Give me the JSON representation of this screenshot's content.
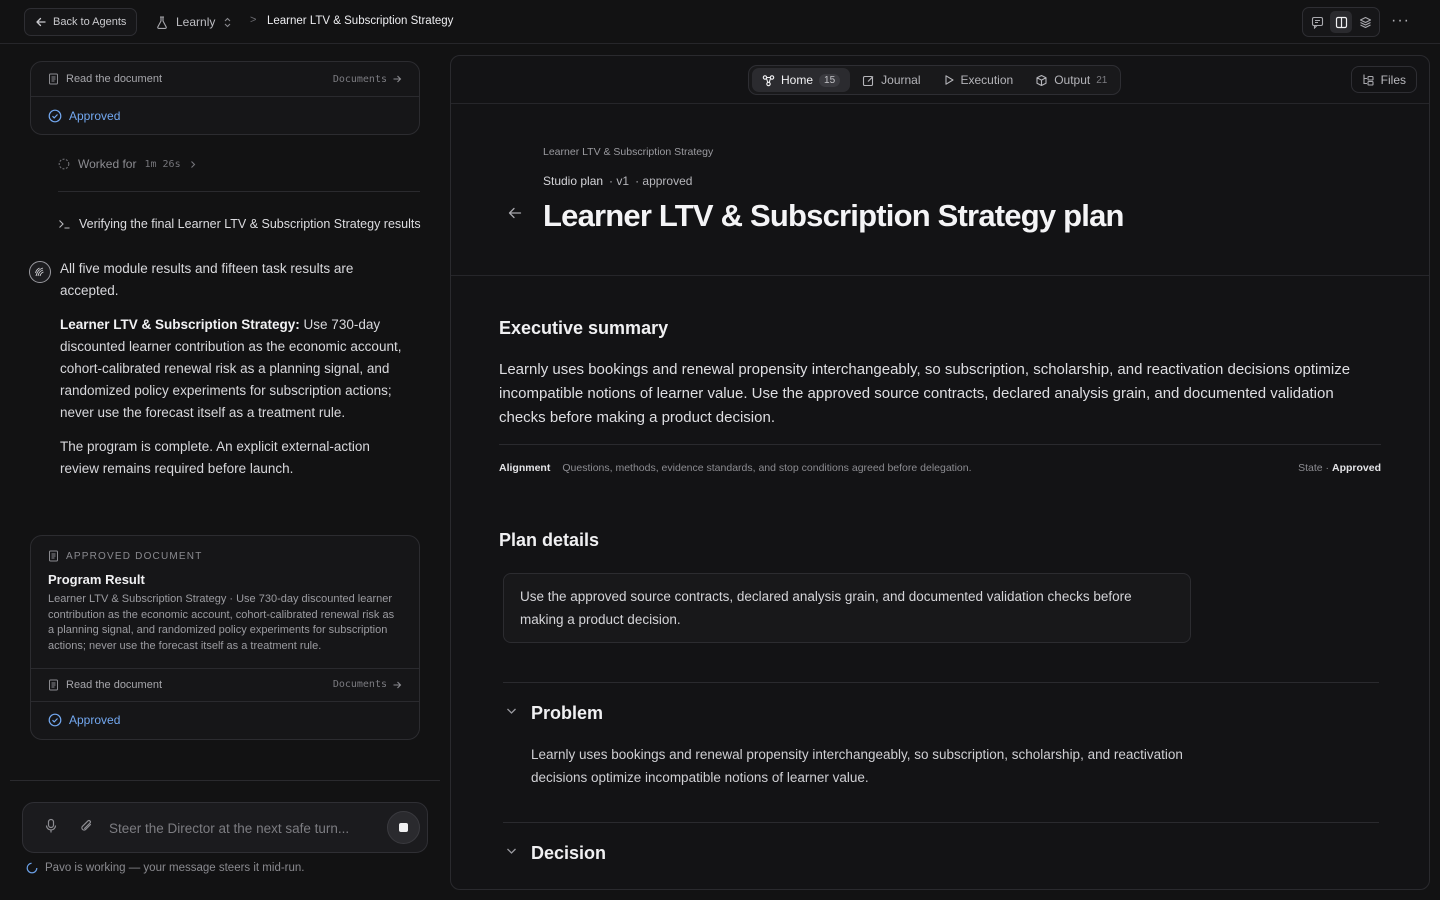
{
  "topbar": {
    "back_label": "Back to Agents",
    "project_name": "Learnly",
    "breadcrumb_sep": ">",
    "breadcrumb_title": "Learner LTV & Subscription Strategy"
  },
  "left": {
    "top_card": {
      "read_label": "Read the document",
      "docs_label": "Documents",
      "approved_label": "Approved"
    },
    "worked_label": "Worked for",
    "worked_duration": "1m 26s",
    "verify_text": "Verifying the final Learner LTV & Subscription Strategy results",
    "message": {
      "p1": "All five module results and fifteen task results are accepted.",
      "p2_bold": "Learner LTV & Subscription Strategy:",
      "p2_rest": " Use 730-day discounted learner contribution as the economic account, cohort-calibrated renewal risk as a planning signal, and randomized policy experiments for subscription actions; never use the forecast itself as a treatment rule.",
      "p3": "The program is complete. An explicit external-action review remains required before launch."
    },
    "doc_card": {
      "kicker": "APPROVED DOCUMENT",
      "title": "Program Result",
      "body": "Learner LTV & Subscription Strategy · Use 730-day discounted learner contribution as the economic account, cohort-calibrated renewal risk as a planning signal, and randomized policy experiments for subscription actions; never use the forecast itself as a treatment rule.",
      "read_label": "Read the document",
      "docs_label": "Documents",
      "approved_label": "Approved"
    },
    "composer": {
      "placeholder": "Steer the Director at the next safe turn..."
    },
    "status_text": "Pavo is working — your message steers it mid-run."
  },
  "right": {
    "tabs": [
      {
        "label": "Home",
        "count": "15"
      },
      {
        "label": "Journal",
        "count": ""
      },
      {
        "label": "Execution",
        "count": ""
      },
      {
        "label": "Output",
        "count": "21"
      }
    ],
    "files_label": "Files",
    "kicker": "Learner LTV & Subscription Strategy",
    "meta_type": "Studio plan",
    "meta_version": "· v1",
    "meta_state": "· approved",
    "title": "Learner LTV & Subscription Strategy plan",
    "summary_heading": "Executive summary",
    "summary_text": "Learnly uses bookings and renewal propensity interchangeably, so subscription, scholarship, and reactivation decisions optimize incompatible notions of learner value. Use the approved source contracts, declared analysis grain, and documented validation checks before making a product decision.",
    "alignment_key": "Alignment",
    "alignment_value": "Questions, methods, evidence standards, and stop conditions agreed before delegation.",
    "state_prefix": "State ·",
    "state_value": "Approved",
    "plan_heading": "Plan details",
    "plan_box": "Use the approved source contracts, declared analysis grain, and documented validation checks before making a product decision.",
    "problem_heading": "Problem",
    "problem_text": "Learnly uses bookings and renewal propensity interchangeably, so subscription, scholarship, and reactivation decisions optimize incompatible notions of learner value.",
    "decision_heading": "Decision"
  },
  "colors": {
    "background": "#121213",
    "accent_blue": "#73a8f0",
    "text_primary": "#f0f0f2"
  }
}
